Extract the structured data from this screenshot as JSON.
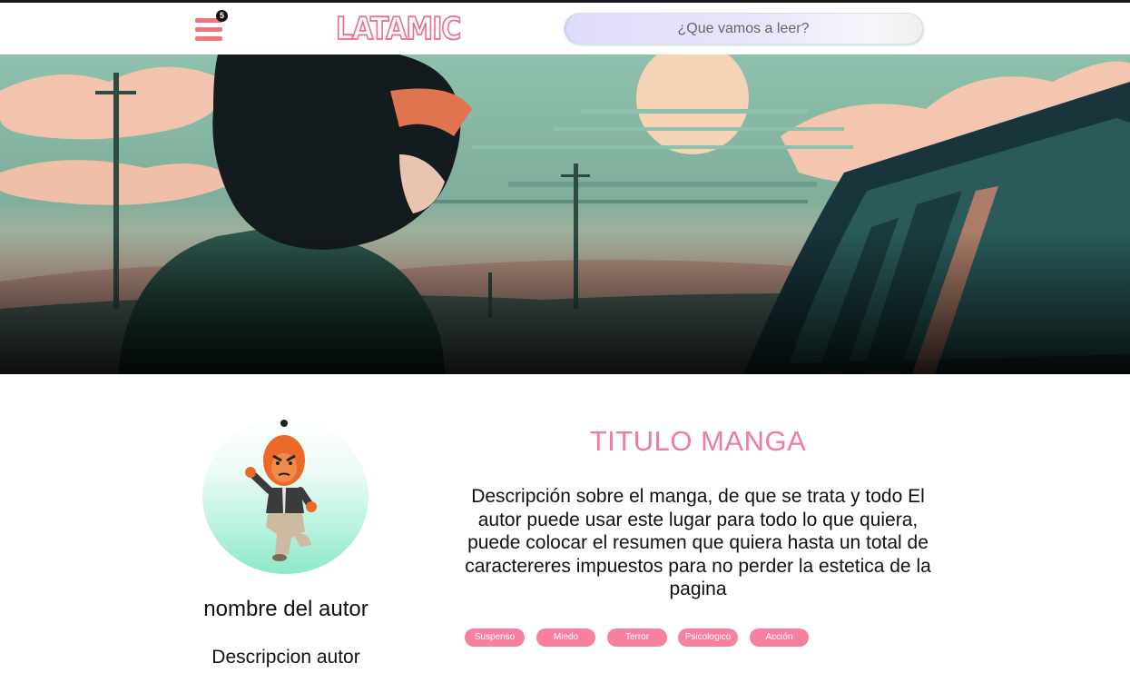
{
  "app": {
    "logo_text": "LATAMIC"
  },
  "header": {
    "menu_badge": "5",
    "search": {
      "placeholder": "¿Que vamos a leer?",
      "value": ""
    }
  },
  "manga": {
    "title": "TITULO MANGA",
    "description": "Descripción sobre el manga, de que se trata y todo El autor puede usar este lugar para todo lo que quiera, puede colocar el resumen que quiera hasta un total de caractereres impuestos para no perder la estetica de la pagina",
    "tags": [
      "Suspenso",
      "Miedo",
      "Terror",
      "Psicologico",
      "Acción"
    ]
  },
  "author": {
    "name": "nombre del autor",
    "description": "Descripcion autor"
  },
  "colors": {
    "accent_pink": "#f07aa0",
    "tag_pink": "#f7809e",
    "menu_coral": "#f2747b",
    "avatar_mint": "#8de9c8"
  },
  "icons": {
    "menu": "hamburger-menu-icon",
    "avatar": "avatar-figure-icon"
  }
}
